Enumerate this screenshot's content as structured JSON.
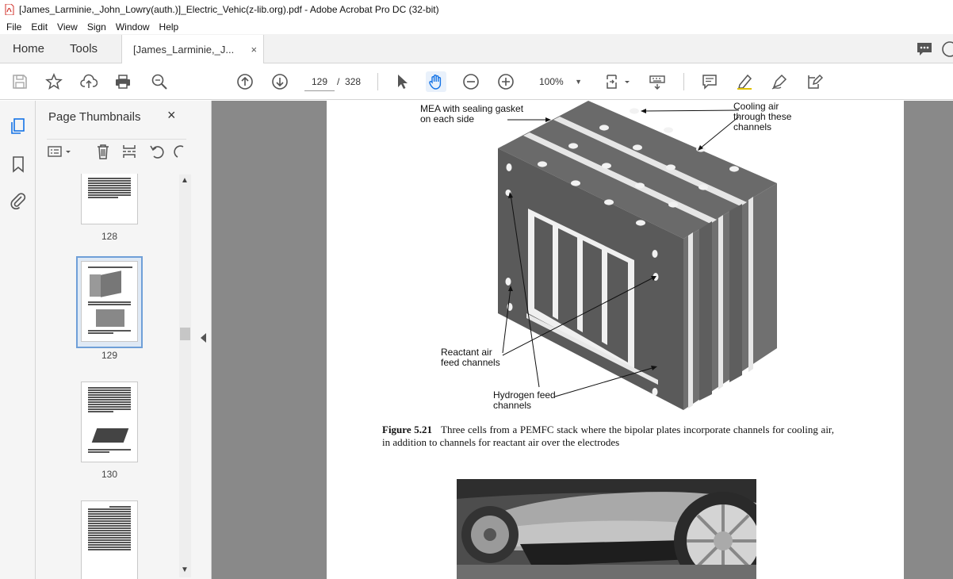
{
  "window": {
    "title": "[James_Larminie,_John_Lowry(auth.)]_Electric_Vehic(z-lib.org).pdf - Adobe Acrobat Pro DC (32-bit)"
  },
  "menu": [
    "File",
    "Edit",
    "View",
    "Sign",
    "Window",
    "Help"
  ],
  "tabs": {
    "home": "Home",
    "tools": "Tools",
    "document": "[James_Larminie,_J...",
    "close": "×"
  },
  "toolbar": {
    "current_page": "129",
    "page_separator": "/",
    "total_pages": "328",
    "zoom": "100%"
  },
  "thumbnails_panel": {
    "title": "Page Thumbnails",
    "close": "×",
    "pages": [
      {
        "label": "128"
      },
      {
        "label": "129",
        "selected": true
      },
      {
        "label": "130"
      },
      {
        "label": ""
      }
    ]
  },
  "document": {
    "figure_number": "Figure 5.21",
    "figure_caption": "Three cells from a PEMFC stack where the bipolar plates incorporate channels for cooling air, in addition to channels for reactant air over the electrodes",
    "annotations": {
      "mea_line1": "MEA with sealing gasket",
      "mea_line2": "on each side",
      "cooling_line1": "Cooling air",
      "cooling_line2": "through these",
      "cooling_line3": "channels",
      "reactant_line1": "Reactant air",
      "reactant_line2": "feed channels",
      "hydrogen_line1": "Hydrogen feed",
      "hydrogen_line2": "channels"
    }
  },
  "colors": {
    "accent": "#1473e6",
    "selection_border": "#6f9fd8",
    "doc_background": "#898989",
    "stack_dark": "#5d5d5d",
    "stack_mid": "#777777"
  }
}
